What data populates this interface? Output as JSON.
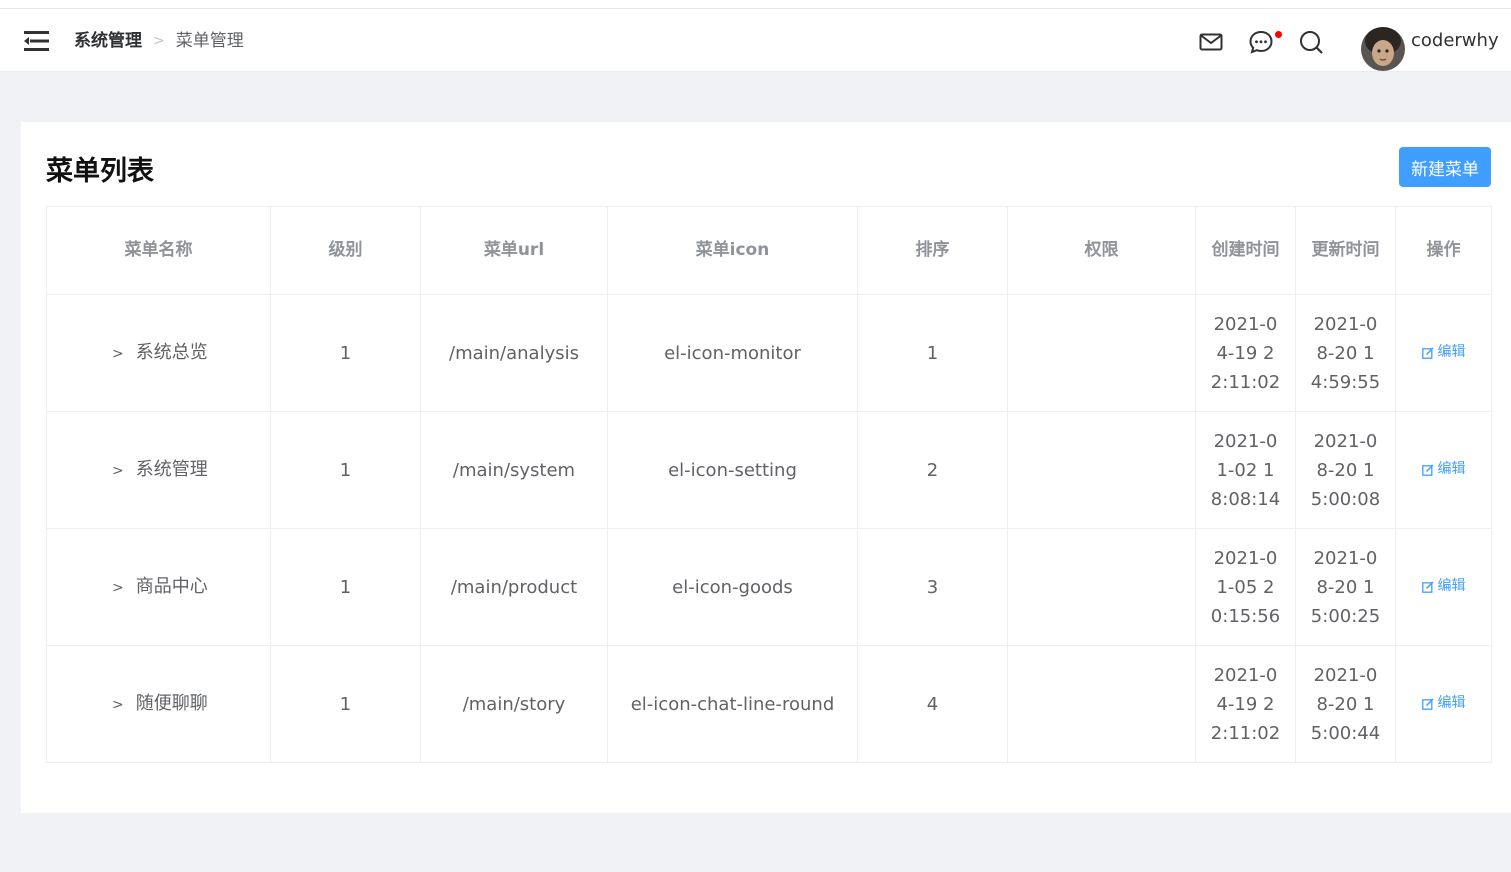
{
  "header": {
    "breadcrumb": [
      "系统管理",
      "菜单管理"
    ],
    "username": "coderwhy",
    "icons": [
      "fold-icon",
      "mail-icon",
      "chat-icon",
      "search-icon"
    ],
    "notification_dot_color": "#ff0000"
  },
  "card": {
    "title": "菜单列表",
    "new_button": "新建菜单"
  },
  "table": {
    "columns": [
      "菜单名称",
      "级别",
      "菜单url",
      "菜单icon",
      "排序",
      "权限",
      "创建时间",
      "更新时间",
      "操作"
    ],
    "rows": [
      {
        "name": "系统总览",
        "level": "1",
        "url": "/main/analysis",
        "icon": "el-icon-monitor",
        "sort": "1",
        "permission": "",
        "created": "2021-04-19 22:11:02",
        "updated": "2021-08-20 14:59:55",
        "action": "编辑"
      },
      {
        "name": "系统管理",
        "level": "1",
        "url": "/main/system",
        "icon": "el-icon-setting",
        "sort": "2",
        "permission": "",
        "created": "2021-01-02 18:08:14",
        "updated": "2021-08-20 15:00:08",
        "action": "编辑"
      },
      {
        "name": "商品中心",
        "level": "1",
        "url": "/main/product",
        "icon": "el-icon-goods",
        "sort": "3",
        "permission": "",
        "created": "2021-01-05 20:15:56",
        "updated": "2021-08-20 15:00:25",
        "action": "编辑"
      },
      {
        "name": "随便聊聊",
        "level": "1",
        "url": "/main/story",
        "icon": "el-icon-chat-line-round",
        "sort": "4",
        "permission": "",
        "created": "2021-04-19 22:11:02",
        "updated": "2021-08-20 15:00:44",
        "action": "编辑"
      }
    ]
  },
  "colors": {
    "accent": "#409eff",
    "background": "#f0f2f5"
  }
}
